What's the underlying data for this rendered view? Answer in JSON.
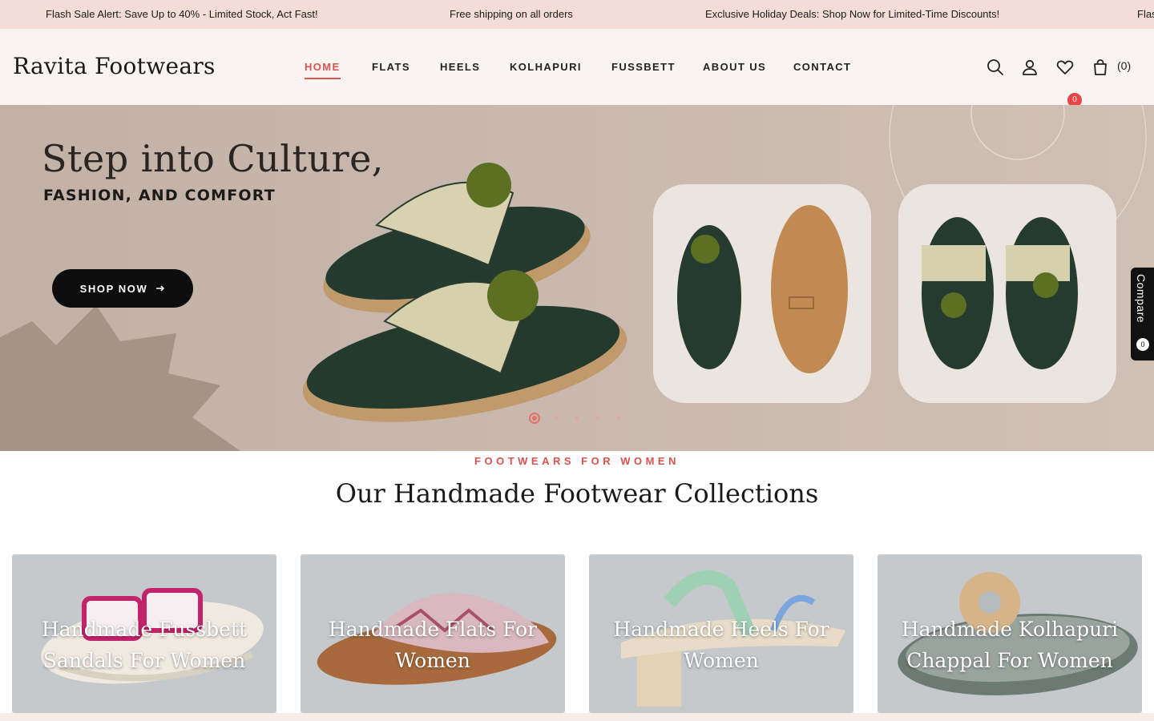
{
  "announcement": {
    "messages": [
      "Flash Sale Alert: Save Up to 40% - Limited Stock, Act Fast!",
      "Free shipping on all orders",
      "Exclusive Holiday Deals: Shop Now for Limited-Time Discounts!",
      "Flas"
    ]
  },
  "header": {
    "logo": "Ravita Footwears",
    "nav": [
      {
        "label": "HOME",
        "active": true
      },
      {
        "label": "FLATS",
        "active": false
      },
      {
        "label": "HEELS",
        "active": false
      },
      {
        "label": "KOLHAPURI",
        "active": false
      },
      {
        "label": "FUSSBETT",
        "active": false
      },
      {
        "label": "ABOUT US",
        "active": false
      },
      {
        "label": "CONTACT",
        "active": false
      }
    ],
    "icons": [
      "search-icon",
      "user-icon",
      "heart-icon",
      "bag-icon"
    ],
    "wishlist_count": "0",
    "cart_count": "(0)"
  },
  "hero": {
    "title": "Step into Culture,",
    "subtitle": "FASHION, AND COMFORT",
    "cta": "SHOP NOW",
    "slides": 5,
    "active_slide": 1
  },
  "compare": {
    "label": "Compare",
    "count": "0"
  },
  "collections": {
    "eyebrow": "FOOTWEARS FOR WOMEN",
    "title": "Our Handmade Footwear Collections",
    "cards": [
      {
        "title": "Handmade Fussbett Sandals For Women"
      },
      {
        "title": "Handmade Flats For Women"
      },
      {
        "title": "Handmade Heels For Women"
      },
      {
        "title": "Handmade Kolhapuri Chappal For Women"
      }
    ]
  },
  "colors": {
    "accent": "#d9534f",
    "announcement_bg": "#f4ddd6",
    "header_bg": "#f9f3f1",
    "hero_bg": "#c4b3a8"
  }
}
